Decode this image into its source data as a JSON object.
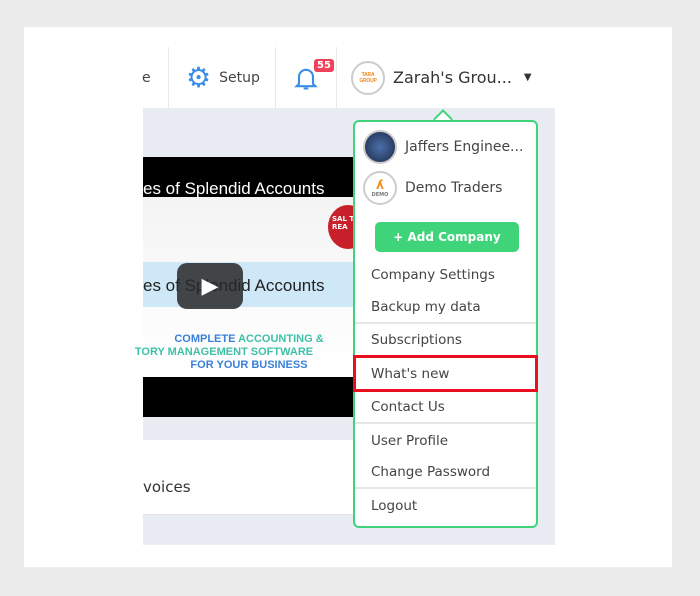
{
  "header": {
    "partial_item": "e",
    "setup_label": "Setup",
    "notifications_count": "55",
    "company_name": "Zarah's Grou...",
    "company_logo_text": "TARA GROUP"
  },
  "video": {
    "title": "es of Splendid Accounts",
    "overlay_title": "es of Splendid Accounts",
    "badge": "SAL TA REA",
    "line1a": "COMPLETE ",
    "line1b": "ACCOUNTING &",
    "line2": "TORY MANAGEMENT SOFTWARE",
    "line3": "FOR YOUR BUSINESS"
  },
  "panel": {
    "heading": "voices"
  },
  "menu": {
    "companies": [
      {
        "name": "Jaffers Enginee..."
      },
      {
        "name": "Demo Traders",
        "logo_text": "DEMO"
      }
    ],
    "add_company": "+ Add Company",
    "items": [
      "Company Settings",
      "Backup my data",
      "Subscriptions",
      "What's new",
      "Contact Us",
      "User Profile",
      "Change Password",
      "Logout"
    ],
    "highlighted": "What's new"
  },
  "colors": {
    "accent_green": "#3fd47a",
    "highlight_red": "#e8101e",
    "badge_red": "#f0405a",
    "icon_blue": "#3a8ee6"
  }
}
